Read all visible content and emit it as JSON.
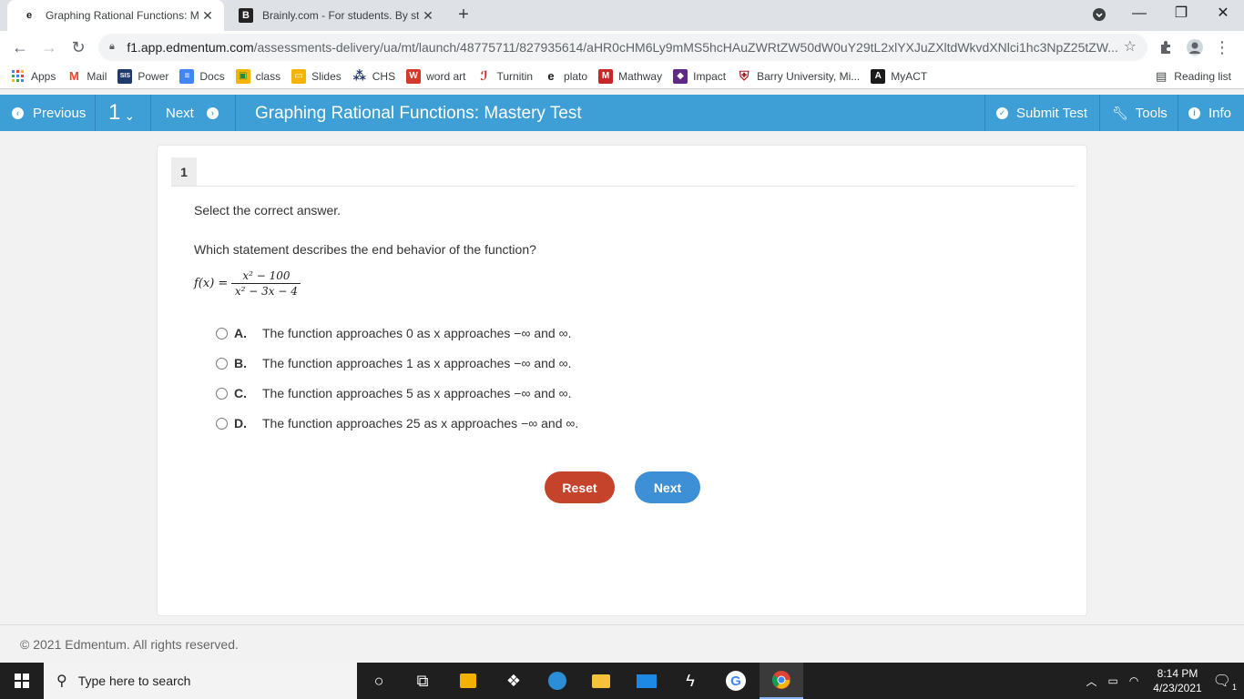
{
  "browser": {
    "tabs": [
      {
        "title": "Graphing Rational Functions: Ma",
        "favicon": "edmentum-icon"
      },
      {
        "title": "Brainly.com - For students. By stu",
        "favicon": "brainly-icon"
      }
    ],
    "url_host": "f1.app.edmentum.com",
    "url_path": "/assessments-delivery/ua/mt/launch/48775711/827935614/aHR0cHM6Ly9mMS5hcHAuZWRtZW50dW0uY29tL2xlYXJuZXltdWkvdXNlci1hc3NpZ25tZW...",
    "bookmarks": [
      "Apps",
      "Mail",
      "Power",
      "Docs",
      "class",
      "Slides",
      "CHS",
      "word art",
      "Turnitin",
      "plato",
      "Mathway",
      "Impact",
      "Barry University, Mi...",
      "MyACT"
    ],
    "reading_list": "Reading list"
  },
  "app": {
    "prev_label": "Previous",
    "question_selector": "1",
    "next_label": "Next",
    "title": "Graphing Rational Functions: Mastery Test",
    "submit_label": "Submit Test",
    "tools_label": "Tools",
    "info_label": "Info"
  },
  "question": {
    "number": "1",
    "instruction": "Select the correct answer.",
    "prompt": "Which statement describes the end behavior of the function?",
    "function_lhs": "f(x) =",
    "numerator": "x² − 100",
    "denominator": "x² − 3x − 4",
    "choices": [
      {
        "letter": "A.",
        "text": "The function approaches 0 as x approaches −∞ and ∞."
      },
      {
        "letter": "B.",
        "text": "The function approaches 1 as x approaches −∞ and ∞."
      },
      {
        "letter": "C.",
        "text": "The function approaches 5 as x approaches −∞ and ∞."
      },
      {
        "letter": "D.",
        "text": "The function approaches 25 as x approaches −∞ and ∞."
      }
    ],
    "reset_label": "Reset",
    "next_label": "Next"
  },
  "footer": {
    "copyright": "© 2021 Edmentum. All rights reserved."
  },
  "taskbar": {
    "search_placeholder": "Type here to search",
    "time": "8:14 PM",
    "date": "4/23/2021",
    "notification_count": "1"
  },
  "colors": {
    "header": "#3d9fd6",
    "reset": "#c5432b",
    "next": "#3d8fd6"
  }
}
